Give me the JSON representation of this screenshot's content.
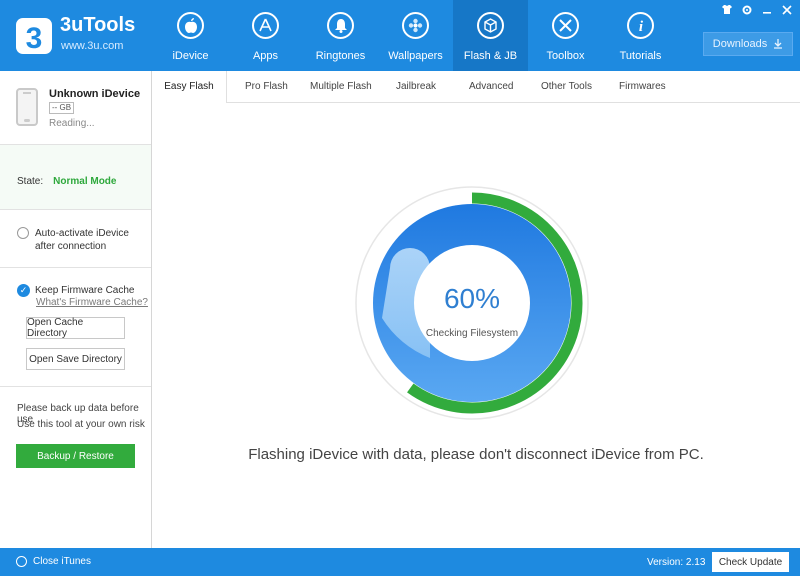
{
  "app": {
    "title": "3uTools",
    "subtitle": "www.3u.com"
  },
  "nav": [
    {
      "label": "iDevice",
      "icon": "apple-icon"
    },
    {
      "label": "Apps",
      "icon": "app-store-icon"
    },
    {
      "label": "Ringtones",
      "icon": "bell-icon"
    },
    {
      "label": "Wallpapers",
      "icon": "flower-icon"
    },
    {
      "label": "Flash & JB",
      "icon": "box-icon",
      "active": true
    },
    {
      "label": "Toolbox",
      "icon": "tools-icon"
    },
    {
      "label": "Tutorials",
      "icon": "info-icon"
    }
  ],
  "downloads": {
    "label": "Downloads"
  },
  "device": {
    "name": "Unknown iDevice",
    "capacity": "-- GB",
    "status": "Reading..."
  },
  "state": {
    "label": "State:",
    "value": "Normal Mode"
  },
  "options": {
    "auto_activate": "Auto-activate iDevice after connection",
    "keep_cache": "Keep Firmware Cache",
    "cache_link": "What's Firmware Cache?",
    "open_cache_dir": "Open Cache Directory",
    "open_save_dir": "Open Save Directory"
  },
  "warning": {
    "line1": "Please back up data before use",
    "line2": "Use this tool at your own risk"
  },
  "backup_button": "Backup / Restore",
  "tabs": [
    "Easy Flash",
    "Pro Flash",
    "Multiple Flash",
    "Jailbreak",
    "Advanced",
    "Other Tools",
    "Firmwares"
  ],
  "progress": {
    "percent_text": "60%",
    "fraction": 0.6,
    "status": "Checking Filesystem"
  },
  "message": "Flashing iDevice with data, please don't disconnect iDevice from PC.",
  "footer": {
    "close_itunes": "Close iTunes",
    "version": "Version: 2.13",
    "check_update": "Check Update"
  },
  "colors": {
    "header_blue": "#1e8ae0",
    "active_nav": "#1677c7",
    "green": "#32ab3d",
    "progress_blue": "#2f7fd1"
  }
}
